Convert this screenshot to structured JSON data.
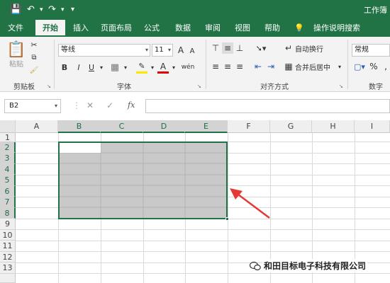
{
  "app": {
    "title": "工作簿"
  },
  "tabs": [
    {
      "label": "文件"
    },
    {
      "label": "开始"
    },
    {
      "label": "插入"
    },
    {
      "label": "页面布局"
    },
    {
      "label": "公式"
    },
    {
      "label": "数据"
    },
    {
      "label": "审阅"
    },
    {
      "label": "视图"
    },
    {
      "label": "帮助"
    },
    {
      "label": "操作说明搜索"
    }
  ],
  "ribbon": {
    "clipboard": {
      "label": "剪贴板",
      "paste": "粘贴"
    },
    "font": {
      "label": "字体",
      "name": "等线",
      "size": "11",
      "bold": "B",
      "italic": "I",
      "underline": "U",
      "grow": "A",
      "shrink": "A",
      "wen": "wén"
    },
    "alignment": {
      "label": "对齐方式",
      "wrap": "自动换行",
      "merge": "合并后居中"
    },
    "number": {
      "label": "数字",
      "format": "常规",
      "percent": "%",
      "comma": ","
    }
  },
  "formula_bar": {
    "name_box": "B2",
    "fx": "fx",
    "cancel": "✕",
    "enter": "✓",
    "value": ""
  },
  "grid": {
    "columns": [
      "A",
      "B",
      "C",
      "D",
      "E",
      "F",
      "G",
      "H",
      "I"
    ],
    "rows": [
      "1",
      "2",
      "3",
      "4",
      "5",
      "6",
      "7",
      "8",
      "9",
      "10",
      "11",
      "12",
      "13"
    ],
    "selected_range": "B2:E8",
    "active_cell": "B2"
  },
  "watermark": {
    "text": "和田目标电子科技有限公司"
  },
  "colors": {
    "accent": "#217346",
    "selection": "#c9c9c9",
    "annotation_arrow": "#e53935"
  }
}
